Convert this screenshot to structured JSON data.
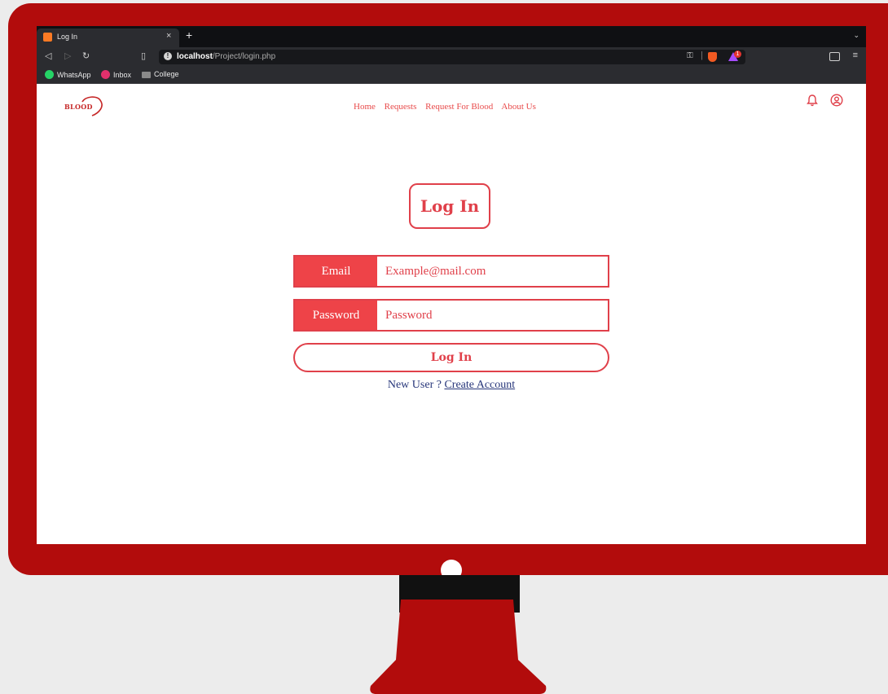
{
  "browser": {
    "tab_title": "Log In",
    "tab_close": "×",
    "new_tab": "+",
    "tab_menu": "⌄",
    "url_host": "localhost",
    "url_path": "/Project/login.php",
    "rewards_count": "1",
    "bookmarks": [
      {
        "label": "WhatsApp",
        "icon": "whatsapp-icon",
        "color": "#25d366"
      },
      {
        "label": "Inbox",
        "icon": "instagram-icon",
        "color": "#e1306c"
      },
      {
        "label": "College",
        "icon": "folder-icon",
        "color": "#8a8a8a"
      }
    ]
  },
  "site": {
    "logo_text": "BLOOD",
    "nav": [
      "Home",
      "Requests",
      "Request For Blood",
      "About Us"
    ],
    "accent": "#e0404a"
  },
  "login": {
    "title": "Log In",
    "email_label": "Email",
    "email_placeholder": "Example@mail.com",
    "password_label": "Password",
    "password_placeholder": "Password",
    "submit_label": "Log  In",
    "signup_prompt": "New User ? ",
    "signup_link": "Create Account"
  }
}
